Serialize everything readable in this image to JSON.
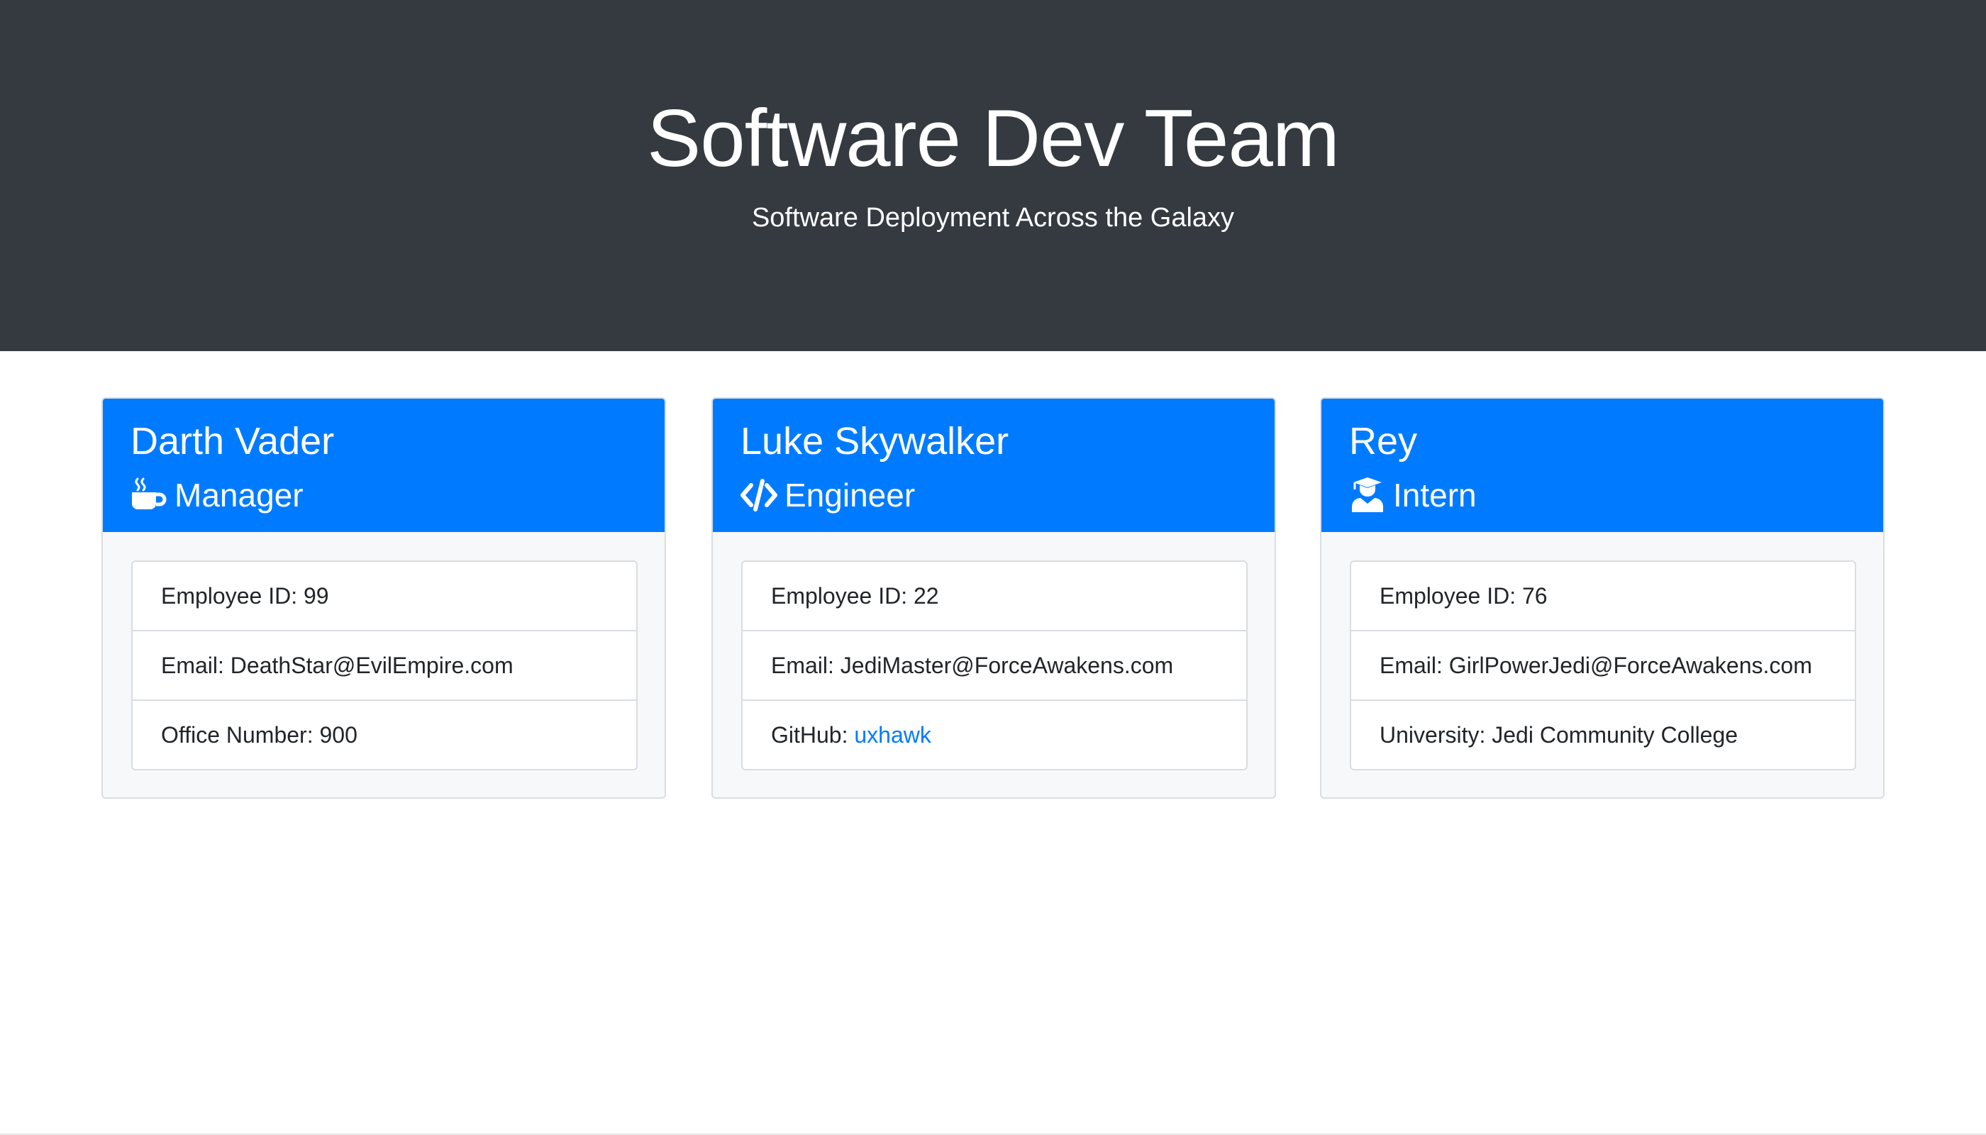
{
  "header": {
    "title": "Software Dev Team",
    "subtitle": "Software Deployment Across the Galaxy"
  },
  "colors": {
    "header_background": "#343a40",
    "card_header": "#007bff",
    "link": "#007bff"
  },
  "cards": [
    {
      "name": "Darth Vader",
      "role": "Manager",
      "role_icon": "mug-hot-icon",
      "details": {
        "id_label": "Employee ID: ",
        "id_value": "99",
        "email_label": "Email: ",
        "email_value": "DeathStar@EvilEmpire.com",
        "extra_label": "Office Number: ",
        "extra_value": "900"
      }
    },
    {
      "name": "Luke Skywalker",
      "role": "Engineer",
      "role_icon": "code-icon",
      "details": {
        "id_label": "Employee ID: ",
        "id_value": "22",
        "email_label": "Email: ",
        "email_value": "JediMaster@ForceAwakens.com",
        "extra_label": "GitHub: ",
        "extra_value": "uxhawk"
      }
    },
    {
      "name": "Rey",
      "role": "Intern",
      "role_icon": "graduate-icon",
      "details": {
        "id_label": "Employee ID: ",
        "id_value": "76",
        "email_label": "Email: ",
        "email_value": "GirlPowerJedi@ForceAwakens.com",
        "extra_label": "University: ",
        "extra_value": "Jedi Community College"
      }
    }
  ]
}
